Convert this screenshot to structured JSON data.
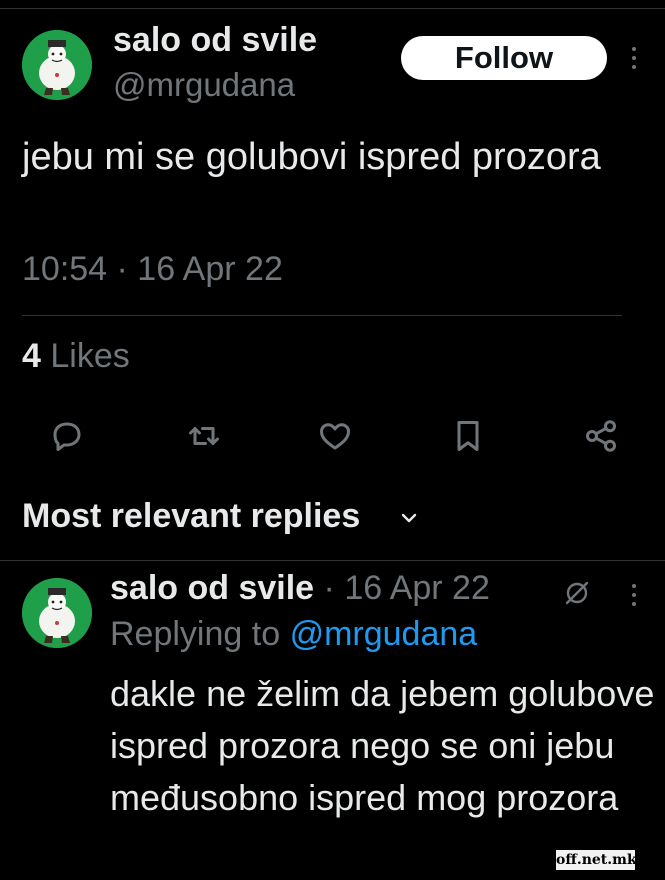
{
  "tweet": {
    "author": {
      "display_name": "salo od svile",
      "handle": "@mrgudana"
    },
    "follow_label": "Follow",
    "text": "jebu mi se golubovi ispred prozora",
    "timestamp": "10:54 · 16 Apr 22",
    "likes_count": "4",
    "likes_label": "Likes"
  },
  "actions": [
    {
      "name": "reply-icon"
    },
    {
      "name": "retweet-icon"
    },
    {
      "name": "like-icon"
    },
    {
      "name": "bookmark-icon"
    },
    {
      "name": "share-icon"
    }
  ],
  "replies_section": {
    "title": "Most relevant replies"
  },
  "reply": {
    "display_name": "salo od svile",
    "date": "· 16 Apr 22",
    "replying_prefix": "Replying to",
    "replying_to": "@mrgudana",
    "text": "dakle ne želim da jebem golubove ispred prozora nego se oni jebu međusobno ispred mog prozora"
  },
  "watermark": "off.net.mk",
  "colors": {
    "background": "#000000",
    "text_primary": "#e7e9ea",
    "text_secondary": "#71767b",
    "link": "#1d9bf0",
    "avatar_bg": "#1f9f4a",
    "follow_bg": "#ffffff"
  }
}
